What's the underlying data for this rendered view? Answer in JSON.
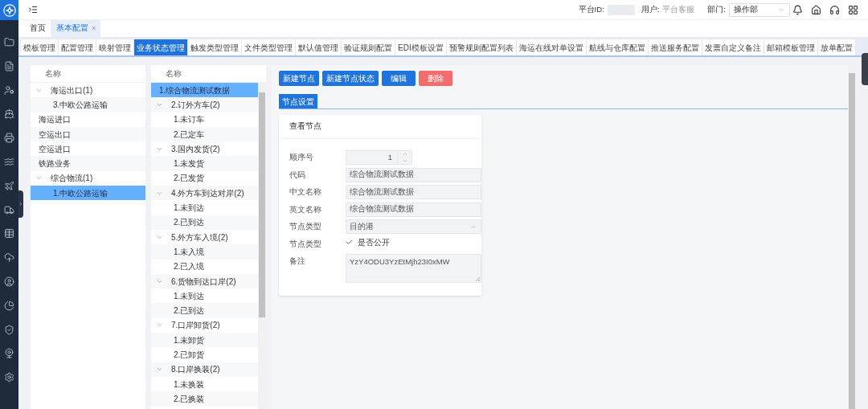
{
  "header": {
    "platform_id_label": "平台ID:",
    "user_label": "用户:",
    "user_value": "平台客服",
    "dept_label": "部门:",
    "dept_value": "操作部"
  },
  "page_tabs": [
    {
      "label": "首页",
      "selected": false
    },
    {
      "label": "基本配置",
      "selected": true,
      "close": "×"
    }
  ],
  "config_tabs": [
    {
      "label": "模板管理",
      "selected": false
    },
    {
      "label": "配置管理",
      "selected": false
    },
    {
      "label": "映射管理",
      "selected": false
    },
    {
      "label": "业务状态管理",
      "selected": true
    },
    {
      "label": "触发类型管理",
      "selected": false
    },
    {
      "label": "文件类型管理",
      "selected": false
    },
    {
      "label": "默认值管理",
      "selected": false
    },
    {
      "label": "验证规则配置",
      "selected": false
    },
    {
      "label": "EDI模板设置",
      "selected": false
    },
    {
      "label": "预警规则配置列表",
      "selected": false
    },
    {
      "label": "海运在线对单设置",
      "selected": false
    },
    {
      "label": "航线与仓库配置",
      "selected": false
    },
    {
      "label": "推送服务配置",
      "selected": false
    },
    {
      "label": "发票自定义备注",
      "selected": false
    },
    {
      "label": "邮箱模板管理",
      "selected": false
    },
    {
      "label": "放单配置",
      "selected": false
    }
  ],
  "business_tree": {
    "header": "名称",
    "items": [
      {
        "label": "海运出口(1)",
        "selected": false,
        "expanded": true,
        "children": [
          {
            "label": "3.中欧公路运输",
            "selected": false
          }
        ]
      },
      {
        "label": "海运进口",
        "selected": false
      },
      {
        "label": "空运出口",
        "selected": false
      },
      {
        "label": "空运进口",
        "selected": false
      },
      {
        "label": "铁路业务",
        "selected": false
      },
      {
        "label": "综合物流(1)",
        "selected": false,
        "expanded": true,
        "children": [
          {
            "label": "1.中欧公路运输",
            "selected": true
          }
        ]
      }
    ]
  },
  "node_tree": {
    "header": "名称",
    "items": [
      {
        "label": "1.综合物流测试数据",
        "selected": true
      },
      {
        "label": "2.订外方车(2)",
        "selected": false,
        "expanded": true,
        "children": [
          {
            "label": "1.未订车",
            "selected": false
          },
          {
            "label": "2.已定车",
            "selected": false
          }
        ]
      },
      {
        "label": "3.国内发货(2)",
        "selected": false,
        "expanded": true,
        "children": [
          {
            "label": "1.未发货",
            "selected": false
          },
          {
            "label": "2.已发货",
            "selected": false
          }
        ]
      },
      {
        "label": "4.外方车到达对岸(2)",
        "selected": false,
        "expanded": true,
        "children": [
          {
            "label": "1.未到达",
            "selected": false
          },
          {
            "label": "2.已到达",
            "selected": false
          }
        ]
      },
      {
        "label": "5.外方车入境(2)",
        "selected": false,
        "expanded": true,
        "children": [
          {
            "label": "1.未入境",
            "selected": false
          },
          {
            "label": "2.已入境",
            "selected": false
          }
        ]
      },
      {
        "label": "6.货物到达口岸(2)",
        "selected": false,
        "expanded": true,
        "children": [
          {
            "label": "1.未到达",
            "selected": false
          },
          {
            "label": "2.已到达",
            "selected": false
          }
        ]
      },
      {
        "label": "7.口岸卸货(2)",
        "selected": false,
        "expanded": true,
        "children": [
          {
            "label": "1.未卸货",
            "selected": false
          },
          {
            "label": "2.已卸货",
            "selected": false
          }
        ]
      },
      {
        "label": "8.口岸换装(2)",
        "selected": false,
        "expanded": true,
        "children": [
          {
            "label": "1.未换装",
            "selected": false
          },
          {
            "label": "2.已换装",
            "selected": false
          }
        ]
      }
    ]
  },
  "actions": [
    {
      "label": "新建节点",
      "kind": "primary"
    },
    {
      "label": "新建节点状态",
      "kind": "primary"
    },
    {
      "label": "编辑",
      "kind": "primary"
    },
    {
      "label": "删除",
      "kind": "danger"
    }
  ],
  "section_tab": "节点设置",
  "card": {
    "title": "查看节点",
    "fields": [
      {
        "kind": "number",
        "label": "顺序号",
        "value": "1"
      },
      {
        "kind": "text",
        "label": "代码",
        "value": "综合物流测试数据"
      },
      {
        "kind": "text",
        "label": "中文名称",
        "value": "综合物流测试数据"
      },
      {
        "kind": "text",
        "label": "英文名称",
        "value": "综合物流测试数据"
      },
      {
        "kind": "select",
        "label": "节点类型",
        "value": "目的港"
      },
      {
        "kind": "checkbox",
        "label": "节点类型",
        "option": "是否公开",
        "checked": true
      },
      {
        "kind": "textarea",
        "label": "备注",
        "value": "YzY4ODU3YzEtMjh23I0xMW"
      }
    ]
  }
}
